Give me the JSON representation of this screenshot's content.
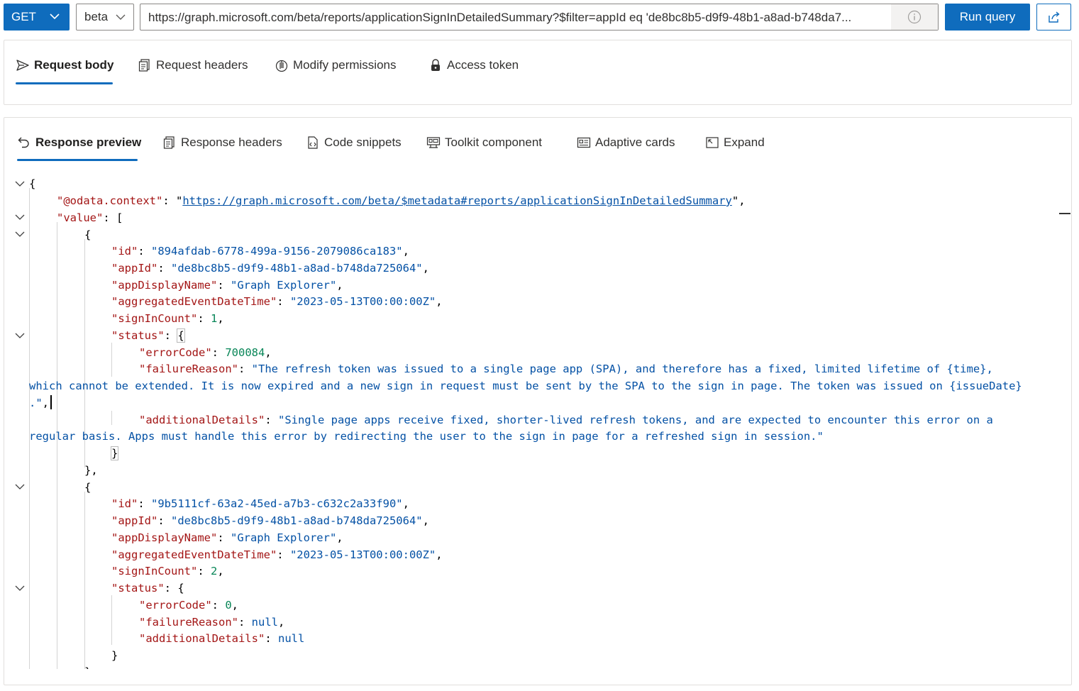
{
  "request": {
    "method": "GET",
    "version": "beta",
    "url": "https://graph.microsoft.com/beta/reports/applicationSignInDetailedSummary?$filter=appId eq 'de8bc8b5-d9f9-48b1-a8ad-b748da7...",
    "run_label": "Run query"
  },
  "request_tabs": [
    {
      "label": "Request body",
      "icon": "send-icon",
      "active": true
    },
    {
      "label": "Request headers",
      "icon": "document-icon"
    },
    {
      "label": "Modify permissions",
      "icon": "hand-icon"
    },
    {
      "label": "Access token",
      "icon": "lock-icon"
    }
  ],
  "response_tabs": [
    {
      "label": "Response preview",
      "icon": "undo-arrow-icon",
      "active": true
    },
    {
      "label": "Response headers",
      "icon": "document-icon"
    },
    {
      "label": "Code snippets",
      "icon": "code-file-icon"
    },
    {
      "label": "Toolkit component",
      "icon": "component-icon"
    },
    {
      "label": "Adaptive cards",
      "icon": "card-icon"
    },
    {
      "label": "Expand",
      "icon": "expand-icon"
    }
  ],
  "json": {
    "open_brace": "{",
    "context_key": "\"@odata.context\"",
    "context_value": "https://graph.microsoft.com/beta/$metadata#reports/applicationSignInDetailedSummary",
    "value_key": "\"value\"",
    "items": [
      {
        "id": "\"894afdab-6778-499a-9156-2079086ca183\"",
        "appId": "\"de8bc8b5-d9f9-48b1-a8ad-b748da725064\"",
        "appDisplayName": "\"Graph Explorer\"",
        "aggregatedEventDateTime": "\"2023-05-13T00:00:00Z\"",
        "signInCount": "1",
        "errorCode": "700084",
        "failureReason_1": "\"The refresh token was issued to a single page app (SPA), and therefore has a fixed, limited lifetime of {time},",
        "failureReason_2": "which cannot be extended. It is now expired and a new sign in request must be sent by the SPA to the sign in page. The token was issued on {issueDate}",
        "failureReason_3": ".\"",
        "additionalDetails_1": "\"Single page apps receive fixed, shorter-lived refresh tokens, and are expected to encounter this error on a",
        "additionalDetails_2": "regular basis. Apps must handle this error by redirecting the user to the sign in page for a refreshed sign in session.\""
      },
      {
        "id": "\"9b5111cf-63a2-45ed-a7b3-c632c2a33f90\"",
        "appId": "\"de8bc8b5-d9f9-48b1-a8ad-b748da725064\"",
        "appDisplayName": "\"Graph Explorer\"",
        "aggregatedEventDateTime": "\"2023-05-13T00:00:00Z\"",
        "signInCount": "2",
        "errorCode": "0",
        "failureReason": "null",
        "additionalDetails": "null"
      }
    ]
  },
  "colors": {
    "accent": "#0f6cbd",
    "json_key": "#a31515",
    "json_string": "#0451a5",
    "json_number": "#098658"
  }
}
